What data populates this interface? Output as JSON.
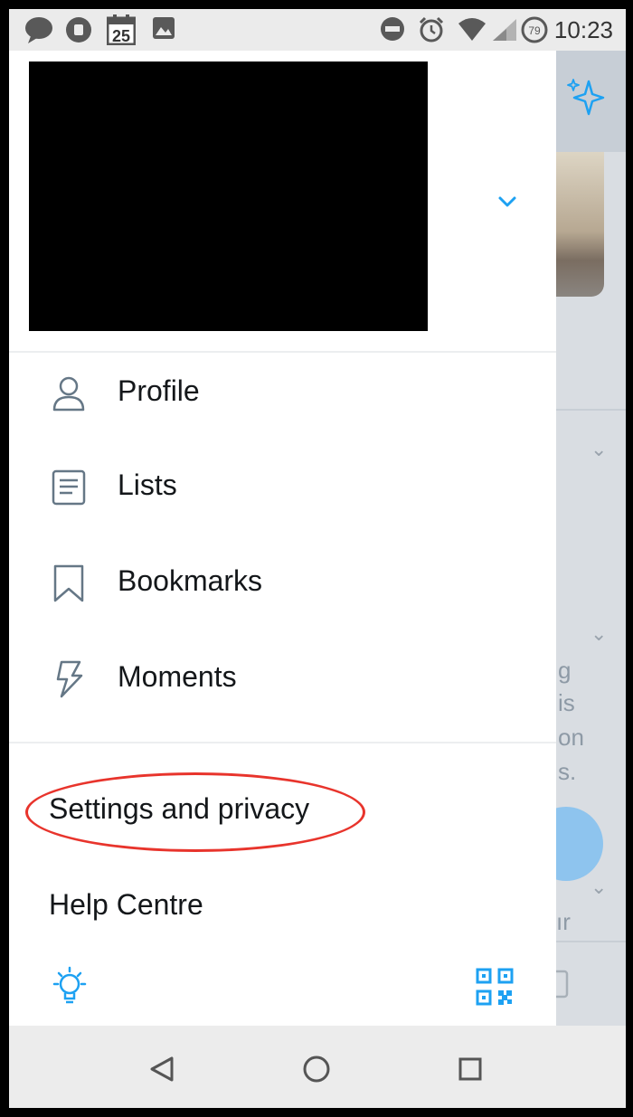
{
  "status_bar": {
    "time": "10:23",
    "calendar_day": "25",
    "icons_left": [
      "chat-bubble-icon",
      "notification-badge-icon",
      "calendar-icon",
      "image-icon"
    ],
    "icons_right": [
      "do-not-disturb-icon",
      "alarm-icon",
      "wifi-icon",
      "signal-icon",
      "battery-icon"
    ],
    "battery_level": "79"
  },
  "drawer": {
    "account_header": {
      "redacted": true
    },
    "menu": [
      {
        "label": "Profile",
        "icon": "person-icon"
      },
      {
        "label": "Lists",
        "icon": "list-icon"
      },
      {
        "label": "Bookmarks",
        "icon": "bookmark-icon"
      },
      {
        "label": "Moments",
        "icon": "lightning-icon"
      }
    ],
    "secondary": [
      {
        "label": "Settings and privacy"
      },
      {
        "label": "Help Centre"
      }
    ],
    "bottom_bar": {
      "left_icon": "lightbulb-icon",
      "right_icon": "qr-code-icon"
    }
  },
  "background_text": [
    "g",
    "is",
    "on",
    "s.",
    "ır"
  ],
  "nav_bar": {
    "buttons": [
      "back-icon",
      "home-icon",
      "recents-icon"
    ]
  },
  "colors": {
    "accent": "#1da1f2",
    "annotation": "#e8342c",
    "text": "#14171a",
    "icon_grey": "#657786"
  }
}
